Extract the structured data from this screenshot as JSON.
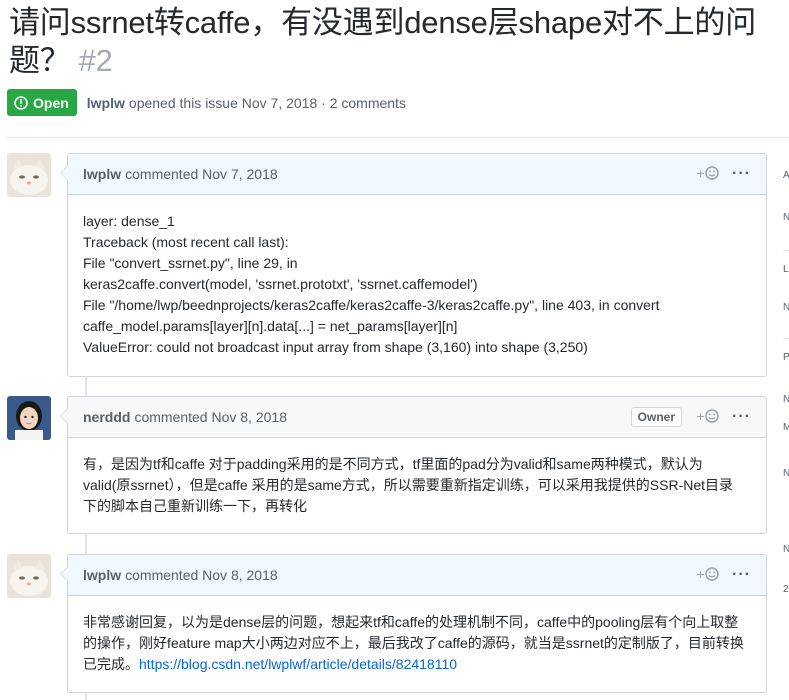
{
  "issue": {
    "title": "请问ssrnet转caffe，有没遇到dense层shape对不上的问题？",
    "number": "#2",
    "state": "Open",
    "author": "lwplw",
    "meta_text": "opened this issue Nov 7, 2018 · 2 comments"
  },
  "comments": [
    {
      "author": "lwplw",
      "date_text": "commented Nov 7, 2018",
      "badge": "",
      "lines": [
        "layer: dense_1",
        "Traceback (most recent call last):",
        "File \"convert_ssrnet.py\", line 29, in",
        "keras2caffe.convert(model, 'ssrnet.prototxt', 'ssrnet.caffemodel')",
        "File \"/home/lwp/beednprojects/keras2caffe/keras2caffe-3/keras2caffe.py\", line 403, in convert",
        "caffe_model.params[layer][n].data[...] = net_params[layer][n]",
        "ValueError: could not broadcast input array from shape (3,160) into shape (3,250)"
      ]
    },
    {
      "author": "nerddd",
      "date_text": "commented Nov 8, 2018",
      "badge": "Owner",
      "lines": [
        "有，是因为tf和caffe 对于padding采用的是不同方式，tf里面的pad分为valid和same两种模式，默认为",
        "valid(原ssrnet），但是caffe 采用的是same方式，所以需要重新指定训练，可以采用我提供的SSR-Net目录",
        "下的脚本自己重新训练一下，再转化"
      ]
    },
    {
      "author": "lwplw",
      "date_text": "commented Nov 8, 2018",
      "badge": "",
      "lines": [
        "非常感谢回复，以为是dense层的问题，想起来tf和caffe的处理机制不同，caffe中的pooling层有个向上取整",
        "的操作，刚好feature map大小两边对应不上，最后我改了caffe的源码，就当是ssrnet的定制版了，目前转换",
        "已完成。"
      ],
      "link": "https://blog.csdn.net/lwplwf/article/details/82418110"
    }
  ],
  "sidebar_fragments": [
    "A",
    "N",
    "L",
    "N",
    "P",
    "N",
    "M",
    "N",
    "N",
    "2"
  ],
  "colors": {
    "open": "#28a745",
    "link": "#0366d6",
    "owner_header": "#f1f8ff"
  },
  "icons": {
    "state": "issue-opened-icon",
    "reaction": "smiley-icon",
    "menu": "kebab-horizontal-icon"
  }
}
